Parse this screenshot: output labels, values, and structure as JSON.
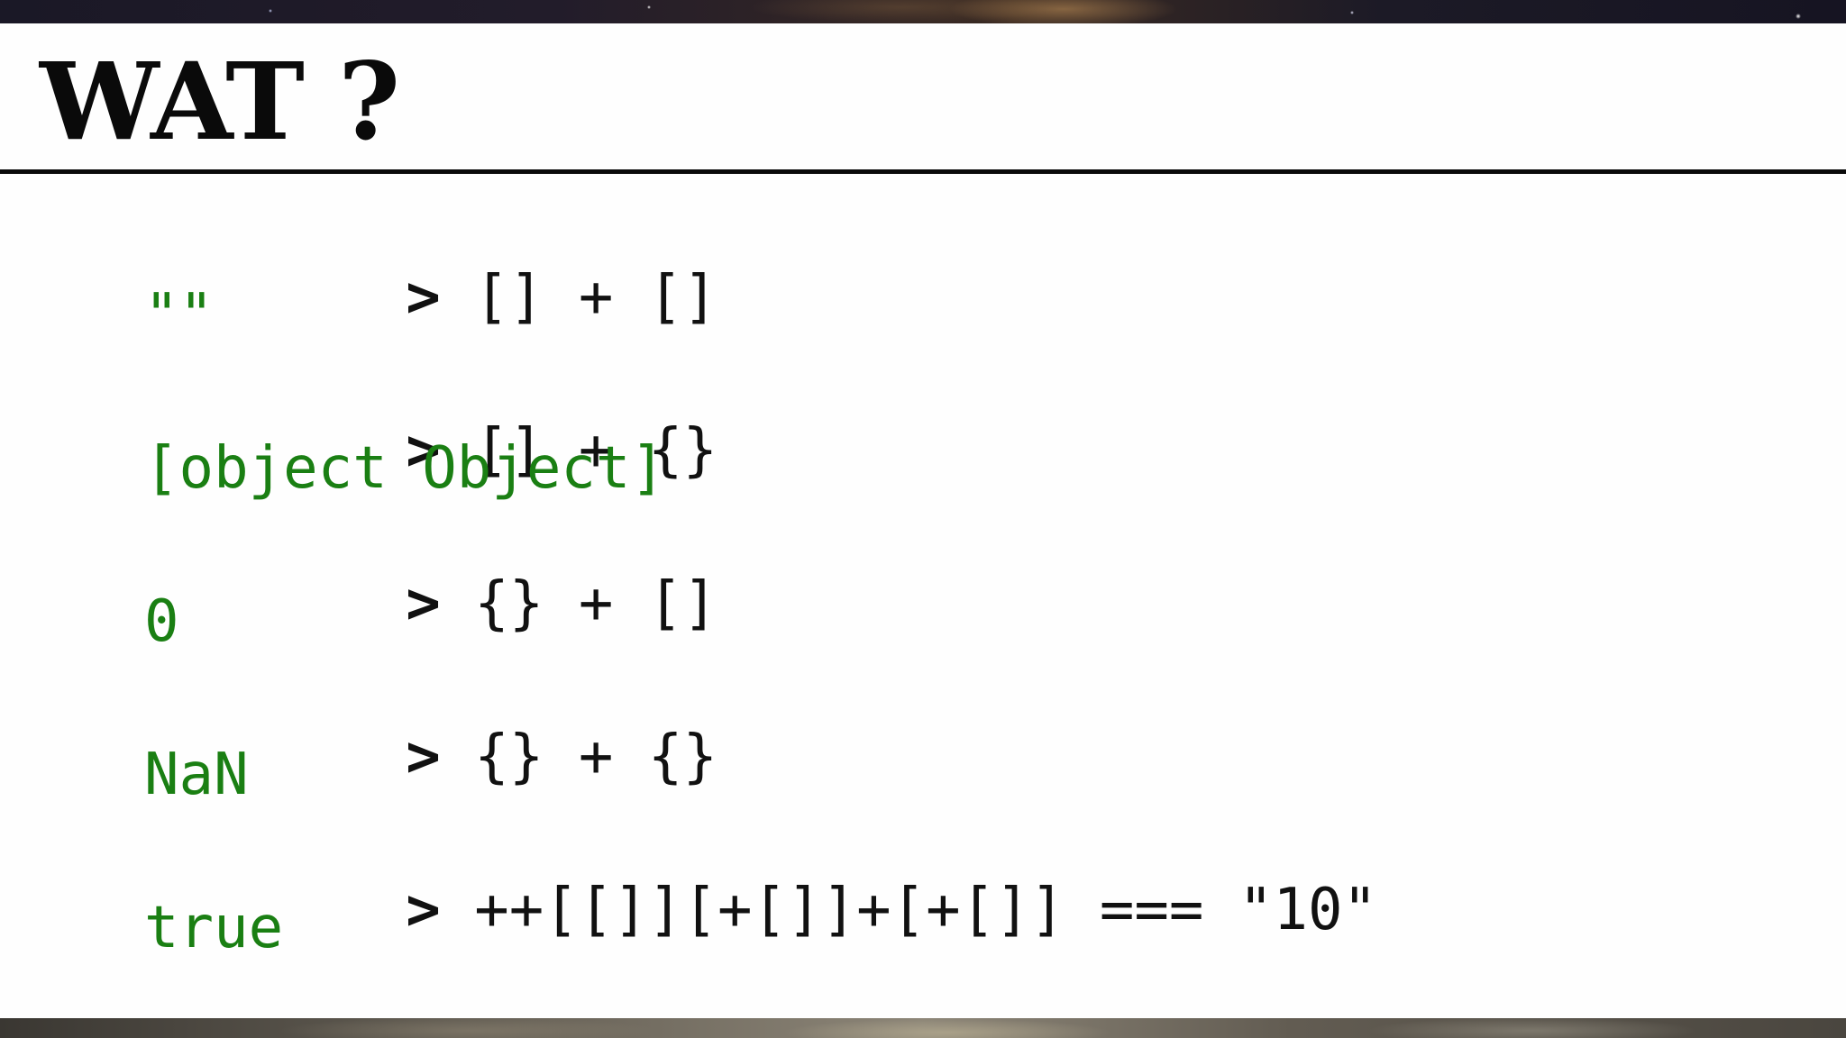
{
  "slide": {
    "title": "WAT ?",
    "prompt_symbol": ">",
    "entries": [
      {
        "command": "[] + []",
        "result": "\"\""
      },
      {
        "command": "[] + {}",
        "result": "[object Object]"
      },
      {
        "command": "{} + []",
        "result": "0"
      },
      {
        "command": "{} + {}",
        "result": "NaN"
      },
      {
        "command": "++[[]][+[]]+[+[]] === \"10\"",
        "result": "true"
      }
    ]
  },
  "colors": {
    "command_text": "#111111",
    "result_text": "#1a7f13",
    "slide_background": "#fefefe"
  }
}
